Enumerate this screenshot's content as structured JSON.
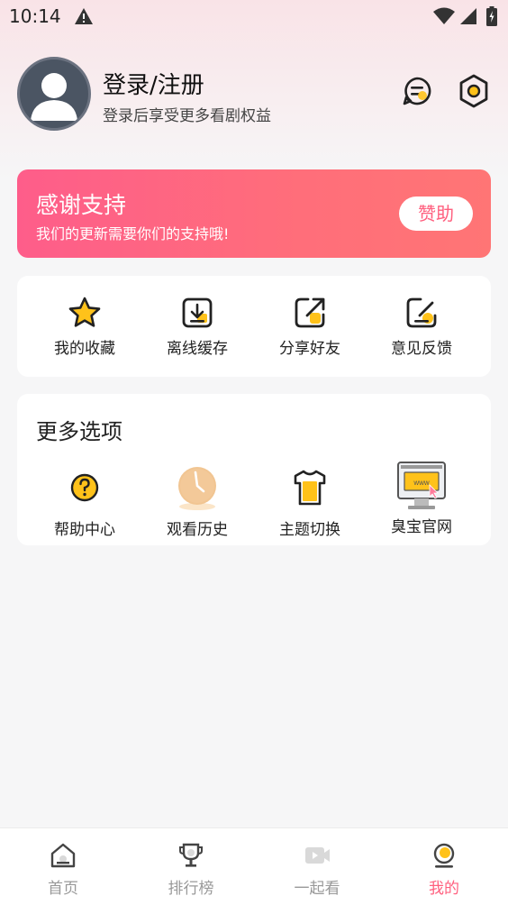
{
  "status_bar": {
    "time": "10:14"
  },
  "profile": {
    "title": "登录/注册",
    "subtitle": "登录后享受更多看剧权益"
  },
  "banner": {
    "title": "感谢支持",
    "subtitle": "我们的更新需要你们的支持哦!",
    "button": "赞助",
    "gradient_start": "#fe5d8a",
    "gradient_end": "#ff7575"
  },
  "actions": [
    {
      "label": "我的收藏",
      "icon": "star-icon"
    },
    {
      "label": "离线缓存",
      "icon": "download-icon"
    },
    {
      "label": "分享好友",
      "icon": "share-icon"
    },
    {
      "label": "意见反馈",
      "icon": "feedback-icon"
    }
  ],
  "more": {
    "title": "更多选项",
    "items": [
      {
        "label": "帮助中心",
        "icon": "help-icon"
      },
      {
        "label": "观看历史",
        "icon": "clock-icon"
      },
      {
        "label": "主题切换",
        "icon": "tshirt-icon"
      },
      {
        "label": "臭宝官网",
        "icon": "website-icon",
        "badge_text": "www"
      }
    ]
  },
  "nav": {
    "items": [
      {
        "label": "首页",
        "icon": "home-icon"
      },
      {
        "label": "排行榜",
        "icon": "trophy-icon"
      },
      {
        "label": "一起看",
        "icon": "video-icon"
      },
      {
        "label": "我的",
        "icon": "profile-icon",
        "active": true
      }
    ]
  },
  "colors": {
    "accent": "#ff5f7e",
    "highlight": "#ffc21a"
  }
}
